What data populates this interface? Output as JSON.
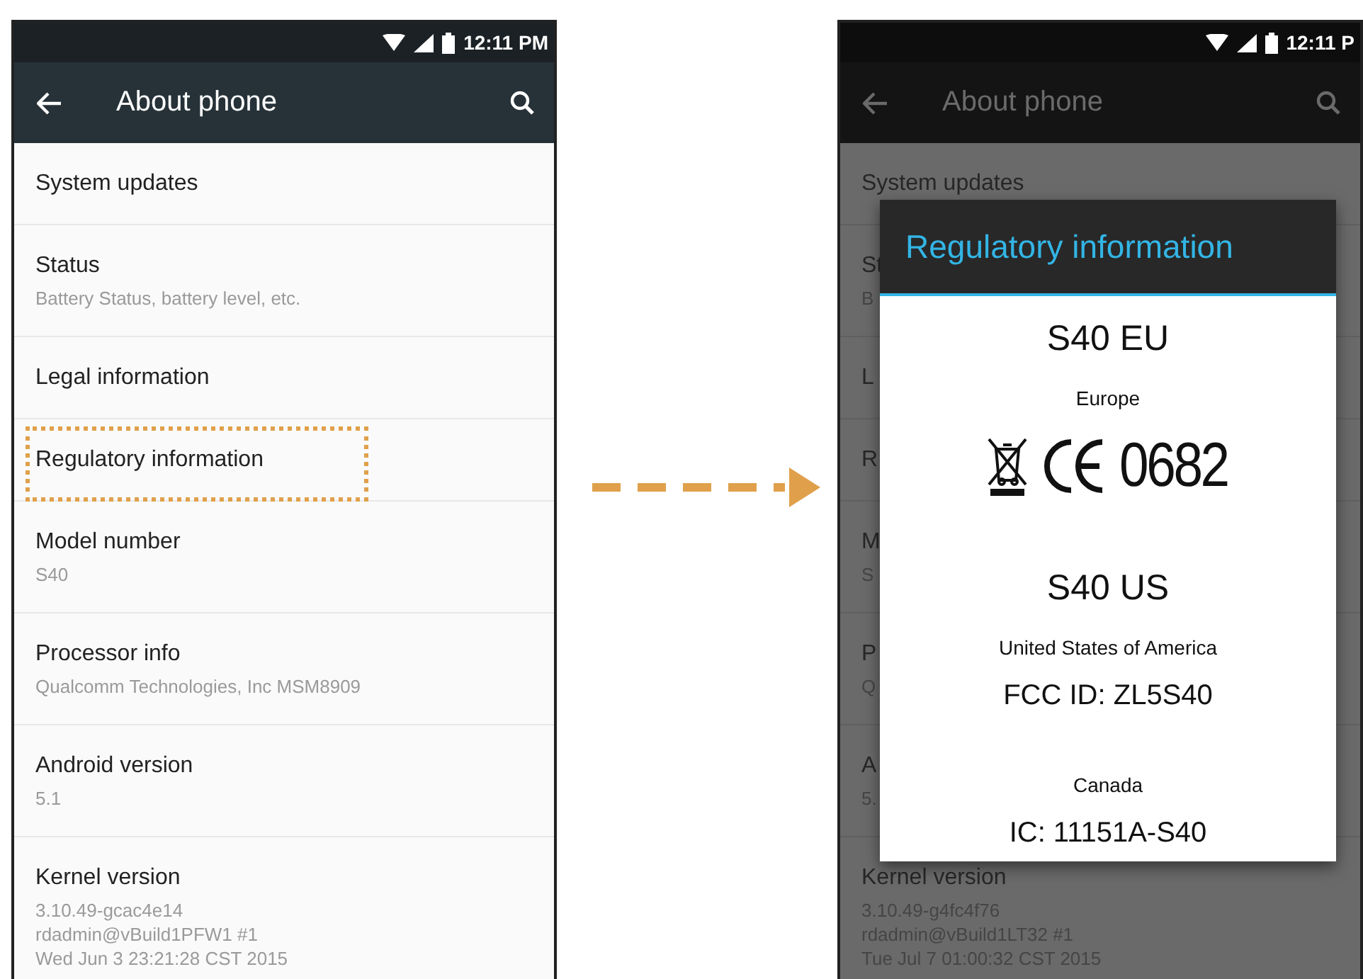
{
  "screens": [
    {
      "status_bar": {
        "time": "12:11 PM"
      },
      "app_bar": {
        "title": "About phone"
      },
      "items": [
        {
          "title": "System updates",
          "highlighted": false
        },
        {
          "title": "Status",
          "summary": [
            "Battery Status, battery level, etc."
          ],
          "highlighted": false
        },
        {
          "title": "Legal information",
          "highlighted": false
        },
        {
          "title": "Regulatory information",
          "highlighted": true
        },
        {
          "title": "Model number",
          "summary": [
            "S40"
          ],
          "highlighted": false
        },
        {
          "title": "Processor info",
          "summary": [
            "Qualcomm Technologies, Inc MSM8909"
          ],
          "highlighted": false
        },
        {
          "title": "Android version",
          "summary": [
            "5.1"
          ],
          "highlighted": false
        },
        {
          "title": "Kernel version",
          "summary": [
            "3.10.49-gcac4e14",
            "rdadmin@vBuild1PFW1 #1",
            "Wed Jun 3 23:21:28 CST 2015"
          ],
          "highlighted": false
        }
      ]
    },
    {
      "status_bar": {
        "time": "12:11 P"
      },
      "app_bar": {
        "title": "About phone"
      },
      "items": [
        {
          "title": "System updates",
          "highlighted": false
        },
        {
          "title": "St",
          "summary": [
            "B"
          ],
          "highlighted": false
        },
        {
          "title": "L",
          "highlighted": false
        },
        {
          "title": "R",
          "highlighted": false
        },
        {
          "title": "M",
          "summary": [
            "S"
          ],
          "highlighted": false
        },
        {
          "title": "P",
          "summary": [
            "Q"
          ],
          "highlighted": false
        },
        {
          "title": "A",
          "summary": [
            "5."
          ],
          "highlighted": false
        },
        {
          "title": "Kernel version",
          "summary": [
            "3.10.49-g4fc4f76",
            "rdadmin@vBuild1LT32 #1",
            "Tue Jul 7 01:00:32 CST 2015"
          ],
          "highlighted": false
        }
      ],
      "dialog": {
        "title": "Regulatory information",
        "sections": [
          {
            "heading": "S40 EU",
            "lines": [
              {
                "kind": "region",
                "text": "Europe"
              },
              {
                "kind": "marks",
                "text": "0682"
              }
            ]
          },
          {
            "heading": "S40 US",
            "lines": [
              {
                "kind": "region",
                "text": "United States of America"
              },
              {
                "kind": "id",
                "text": "FCC ID: ZL5S40"
              }
            ]
          },
          {
            "lines": [
              {
                "kind": "region",
                "text": "Canada"
              },
              {
                "kind": "id",
                "text": "IC: 11151A-S40"
              }
            ]
          }
        ]
      }
    }
  ]
}
